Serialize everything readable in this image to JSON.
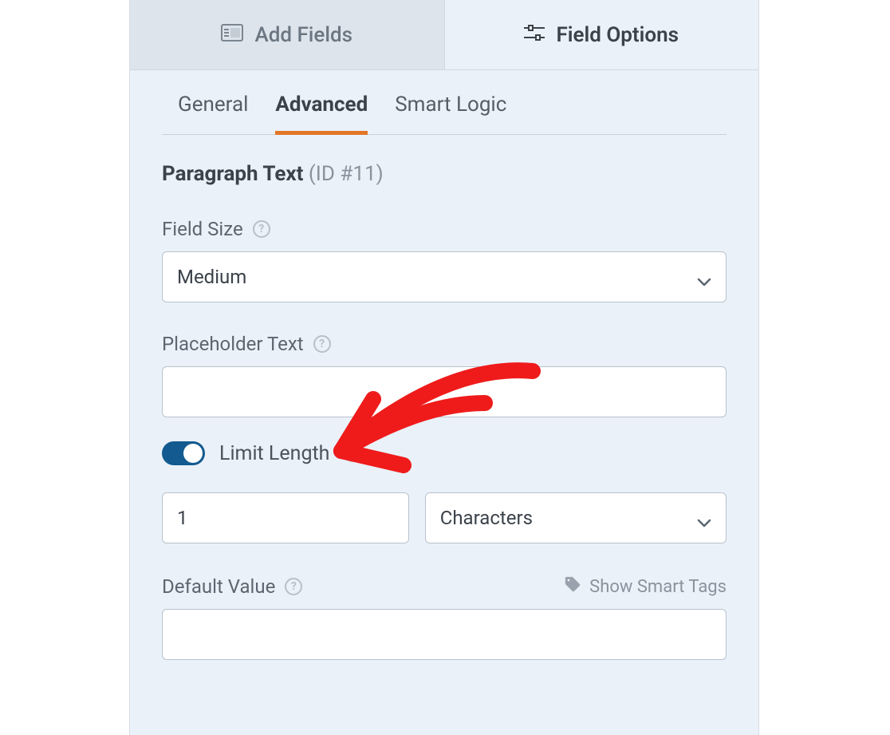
{
  "topTabs": {
    "addFields": "Add Fields",
    "fieldOptions": "Field Options"
  },
  "subTabs": {
    "general": "General",
    "advanced": "Advanced",
    "smartLogic": "Smart Logic"
  },
  "fieldHeader": {
    "name": "Paragraph Text",
    "id": "(ID #11)"
  },
  "fieldSize": {
    "label": "Field Size",
    "value": "Medium"
  },
  "placeholderText": {
    "label": "Placeholder Text",
    "value": ""
  },
  "limitLength": {
    "label": "Limit Length",
    "enabled": true,
    "count": "1",
    "unit": "Characters"
  },
  "defaultValue": {
    "label": "Default Value",
    "smartTags": "Show Smart Tags",
    "value": ""
  }
}
